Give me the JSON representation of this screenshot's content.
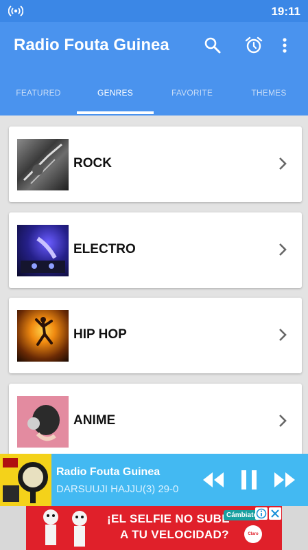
{
  "status_bar": {
    "time": "19:11",
    "radio_icon": "radio-broadcast-icon"
  },
  "app_bar": {
    "title": "Radio Fouta Guinea",
    "icons": [
      "search-icon",
      "alarm-clock-icon",
      "more-vert-icon"
    ]
  },
  "tabs": [
    {
      "label": "FEATURED",
      "active": false
    },
    {
      "label": "GENRES",
      "active": true
    },
    {
      "label": "FAVORITE",
      "active": false
    },
    {
      "label": "THEMES",
      "active": false
    }
  ],
  "genres": [
    {
      "label": "ROCK"
    },
    {
      "label": "ELECTRO"
    },
    {
      "label": "HIP HOP"
    },
    {
      "label": "ANIME"
    }
  ],
  "player": {
    "title": "Radio Fouta Guinea",
    "subtitle": "DARSUUJI HAJJU(3) 29-0",
    "icons": [
      "rewind-icon",
      "pause-icon",
      "fast-forward-icon"
    ]
  },
  "ad": {
    "line1": "¡EL SELFIE NO SUBE",
    "line2": "A TU VELOCIDAD?",
    "brand_badge": "Cámbiate",
    "logo_text": "Claro"
  },
  "colors": {
    "status_bar": "#3b87e6",
    "app_bar": "#4a93ee",
    "player": "#43b9f2",
    "ad_red": "#e0202a"
  }
}
